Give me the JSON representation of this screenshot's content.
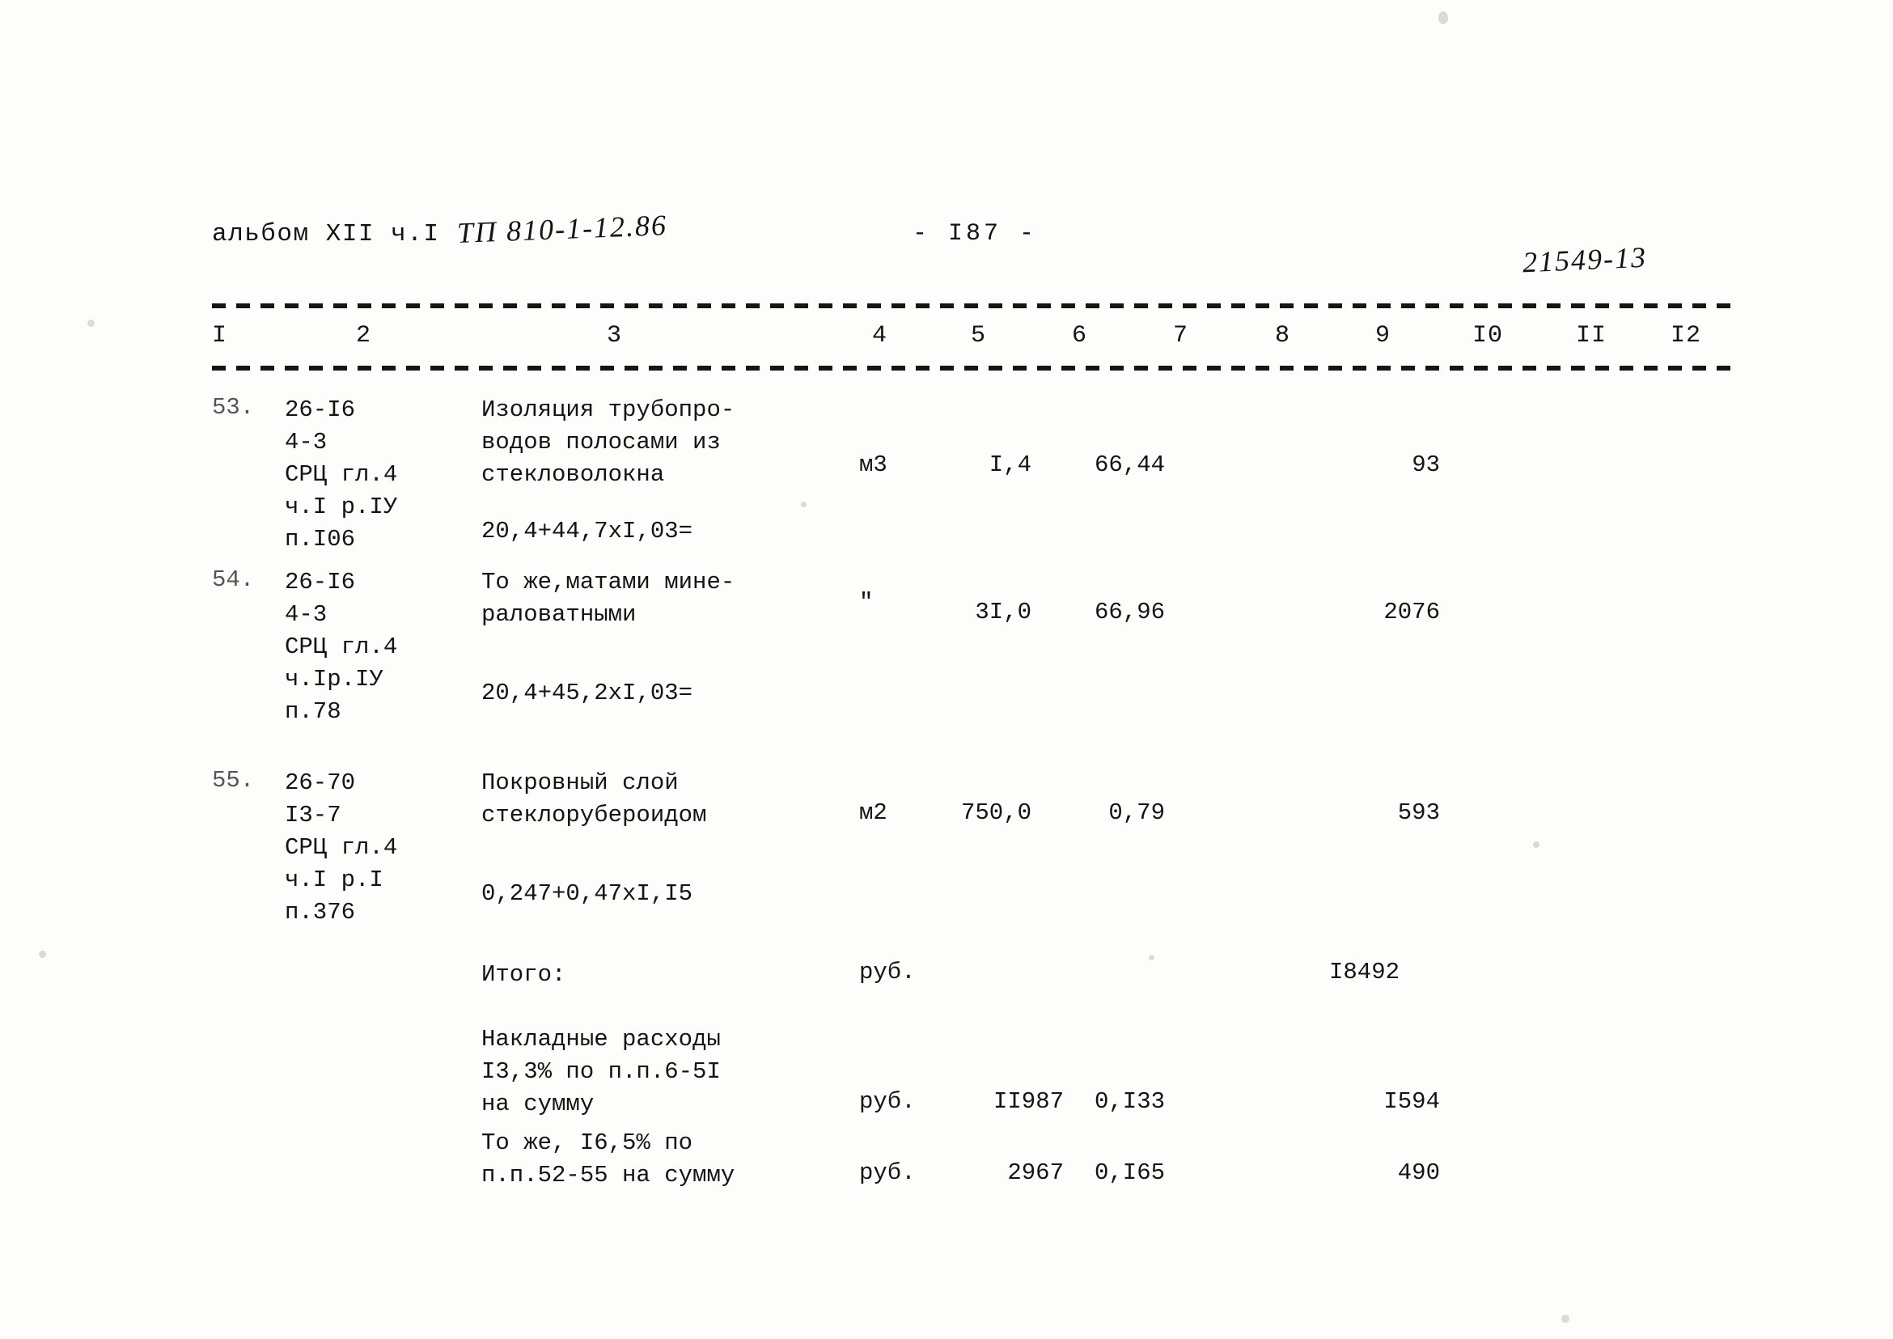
{
  "header": {
    "album_line": "альбом XII ч.I",
    "tp_code": "ТП 810-1-12.86",
    "page_number": "- I87 -",
    "doc_number": "21549-13"
  },
  "table": {
    "column_numbers": [
      "I",
      "2",
      "3",
      "4",
      "5",
      "6",
      "7",
      "8",
      "9",
      "I0",
      "II",
      "I2"
    ],
    "rows": [
      {
        "num": "53.",
        "code": "26-I6\n4-3\nСРЦ гл.4\nч.I р.IУ\nп.I06",
        "desc": "Изоляция трубопро-\nводов полосами из\nстекловолокна",
        "formula": "20,4+44,7хI,03=",
        "unit": "м3",
        "qty": "I,4",
        "price": "66,44",
        "total": "93"
      },
      {
        "num": "54.",
        "code": "26-I6\n4-3\nСРЦ гл.4\nч.Iр.IУ\nп.78",
        "desc": "То же,матами мине-\nраловатными",
        "formula": "20,4+45,2хI,03=",
        "unit": "\"",
        "qty": "3I,0",
        "price": "66,96",
        "total": "2076"
      },
      {
        "num": "55.",
        "code": "26-70\nI3-7\nСРЦ гл.4\nч.I р.I\nп.376",
        "desc": "Покровный слой\nстеклорубероидом",
        "formula": "0,247+0,47хI,I5",
        "unit": "м2",
        "qty": "750,0",
        "price": "0,79",
        "total": "593"
      }
    ],
    "summary_rows": [
      {
        "desc": "Итого:",
        "unit": "руб.",
        "qty": "",
        "price": "",
        "total": "I8492"
      },
      {
        "desc": "Накладные расходы\nI3,3% по п.п.6-5I\nна сумму",
        "unit": "руб.",
        "qty": "II987",
        "price": "0,I33",
        "total": "I594"
      },
      {
        "desc": "То же, I6,5% по\nп.п.52-55 на сумму",
        "unit": "руб.",
        "qty": "2967",
        "price": "0,I65",
        "total": "490"
      }
    ]
  }
}
